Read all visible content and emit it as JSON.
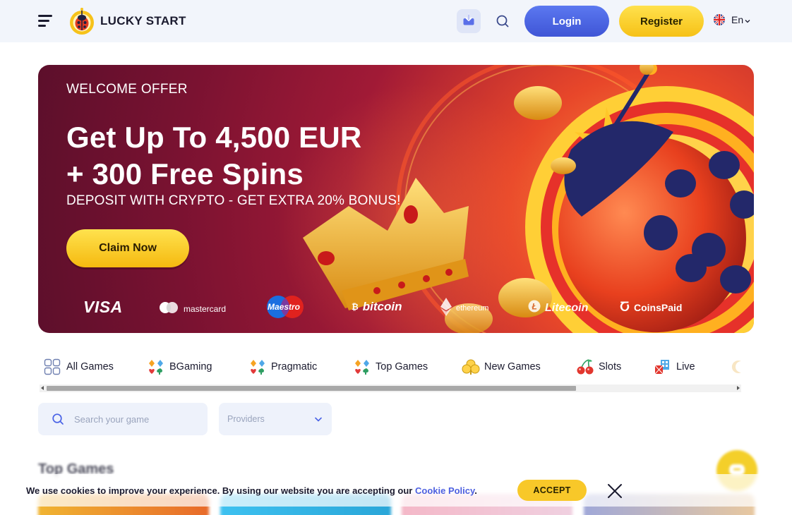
{
  "header": {
    "logo_text": "LUCKY START",
    "login_label": "Login",
    "register_label": "Register",
    "language": "En",
    "icons": [
      "menu-icon",
      "download-icon",
      "search-icon",
      "uk-flag-icon",
      "chevron-down-icon"
    ]
  },
  "hero": {
    "eyebrow": "WELCOME OFFER",
    "title_line1": "Get Up To 4,500 EUR",
    "title_line2": "+ 300 Free Spins",
    "subtitle": "DEPOSIT WITH CRYPTO - GET EXTRA 20% BONUS!",
    "cta_label": "Claim Now",
    "payments": {
      "visa": "VISA",
      "mastercard": "mastercard",
      "maestro": "Maestro",
      "bitcoin": "bitcoin",
      "ethereum": "ethereum",
      "litecoin": "Litecoin",
      "coinspaid": "CoinsPaid"
    }
  },
  "categories": [
    {
      "label": "All Games",
      "icon": "grid-icon"
    },
    {
      "label": "BGaming",
      "icon": "card-suits-icon"
    },
    {
      "label": "Pragmatic",
      "icon": "card-suits-icon"
    },
    {
      "label": "Top Games",
      "icon": "card-suits-icon"
    },
    {
      "label": "New Games",
      "icon": "clover-icon"
    },
    {
      "label": "Slots",
      "icon": "cherries-icon"
    },
    {
      "label": "Live",
      "icon": "live-icon"
    }
  ],
  "filters": {
    "search_placeholder": "Search your game",
    "providers_label": "Providers"
  },
  "section": {
    "title": "Top Games"
  },
  "cookie": {
    "text": "We use cookies to improve your experience. By using our website you are accepting our ",
    "link_label": "Cookie Policy",
    "period": ".",
    "accept_label": "ACCEPT"
  },
  "colors": {
    "primary_blue": "#4a63e6",
    "accent_yellow": "#f8c829",
    "hero_red": "#a11a36",
    "header_bg": "#f2f5fb"
  }
}
